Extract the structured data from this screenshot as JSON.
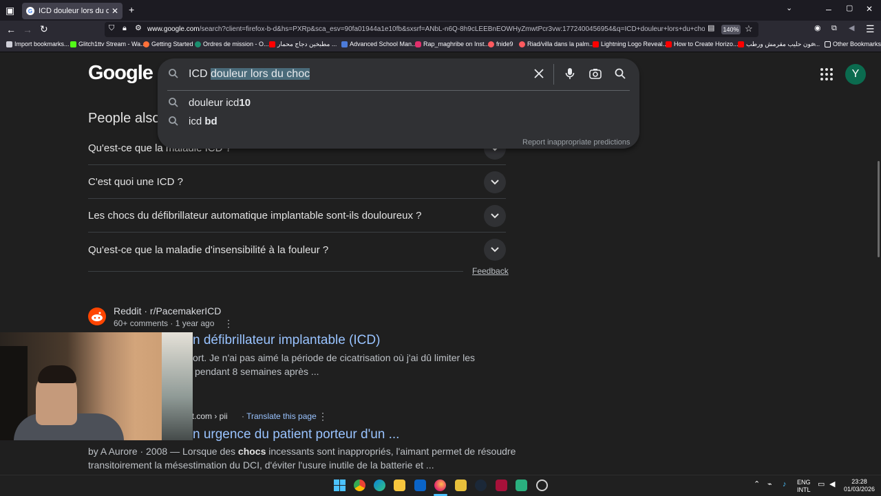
{
  "browser": {
    "tab_title": "ICD douleur lors du choc - Goo",
    "tab_favicon": "G",
    "url_host": "www.google.com",
    "url_rest": "/search?client=firefox-b-d&hs=PXRp&sca_esv=90fa01944a1e10fb&sxsrf=ANbL-n6Q-8h9cLEEBnEOWHyZmwtPcr3vw:1772400456954&q=ICD+douleur+lors+du+choc&source=lnms",
    "zoom": "140%",
    "bookmarks": [
      {
        "label": "Import bookmarks...",
        "color": "#cfcfd8"
      },
      {
        "label": "Glitch1ttv Stream - Wa...",
        "color": "#53fc18"
      },
      {
        "label": "Getting Started",
        "color": "#ff7139"
      },
      {
        "label": "Ordres de mission - O...",
        "color": "#1a8f6f"
      },
      {
        "label": "مطبخين دجاج محمار ...",
        "color": "#ff0000"
      },
      {
        "label": "Advanced School Man...",
        "color": "#4c7bd9"
      },
      {
        "label": "Rap_maghribe on Inst...",
        "color": "#e1306c"
      },
      {
        "label": "fnide9",
        "color": "#ff5a5f"
      },
      {
        "label": "Riad/villa dans la palm...",
        "color": "#ff5a5f"
      },
      {
        "label": "Lightning Logo Reveal...",
        "color": "#ff0000"
      },
      {
        "label": "How to Create Horizo...",
        "color": "#ff0000"
      },
      {
        "label": "عون حليب مقرمش ورطب...",
        "color": "#ff0000"
      }
    ],
    "other_bookmarks": "Other Bookmarks"
  },
  "google": {
    "logo": "Google",
    "avatar_letter": "Y",
    "search": {
      "typed": "ICD ",
      "selected": "douleur lors du choc",
      "suggestions": [
        {
          "normal": "douleur icd",
          "bold": "10"
        },
        {
          "normal": "icd ",
          "bold": "bd"
        }
      ],
      "report": "Report inappropriate predictions"
    },
    "paa_title": "People also ask",
    "questions": [
      "Qu'est-ce que la maladie ICD ?",
      "C'est quoi une ICD ?",
      "Les chocs du défibrillateur automatique implantable sont-ils douloureux  ?",
      "Qu'est-ce que la maladie d'insensibilité à la fouleur ?"
    ],
    "feedback": "Feedback",
    "results": [
      {
        "source": "Reddit · r/PacemakerICD",
        "meta": "60+ comments · 1 year ago",
        "title": "n défibrillateur implantable (ICD)",
        "snippet1": "ort. Je n'ai pas aimé la période de cicatrisation où j'ai dû limiter les",
        "snippet2": "pendant 8 semaines après ..."
      },
      {
        "source": "ect.com › pii",
        "translate": "Translate this page",
        "title": "n urgence du patient porteur d'un ...",
        "snippet_prefix": "by A Aurore · 2008 — Lorsque des ",
        "snippet_bold": "chocs",
        "snippet_suffix": " incessants sont inappropriés, l'aimant permet de résoudre",
        "snippet2": "transitoirement la mésestimation du DCI, d'éviter l'usure inutile de la batterie et ..."
      }
    ]
  },
  "taskbar": {
    "lang1": "ENG",
    "lang2": "INTL",
    "time": "23:28",
    "date": "01/03/2026"
  }
}
